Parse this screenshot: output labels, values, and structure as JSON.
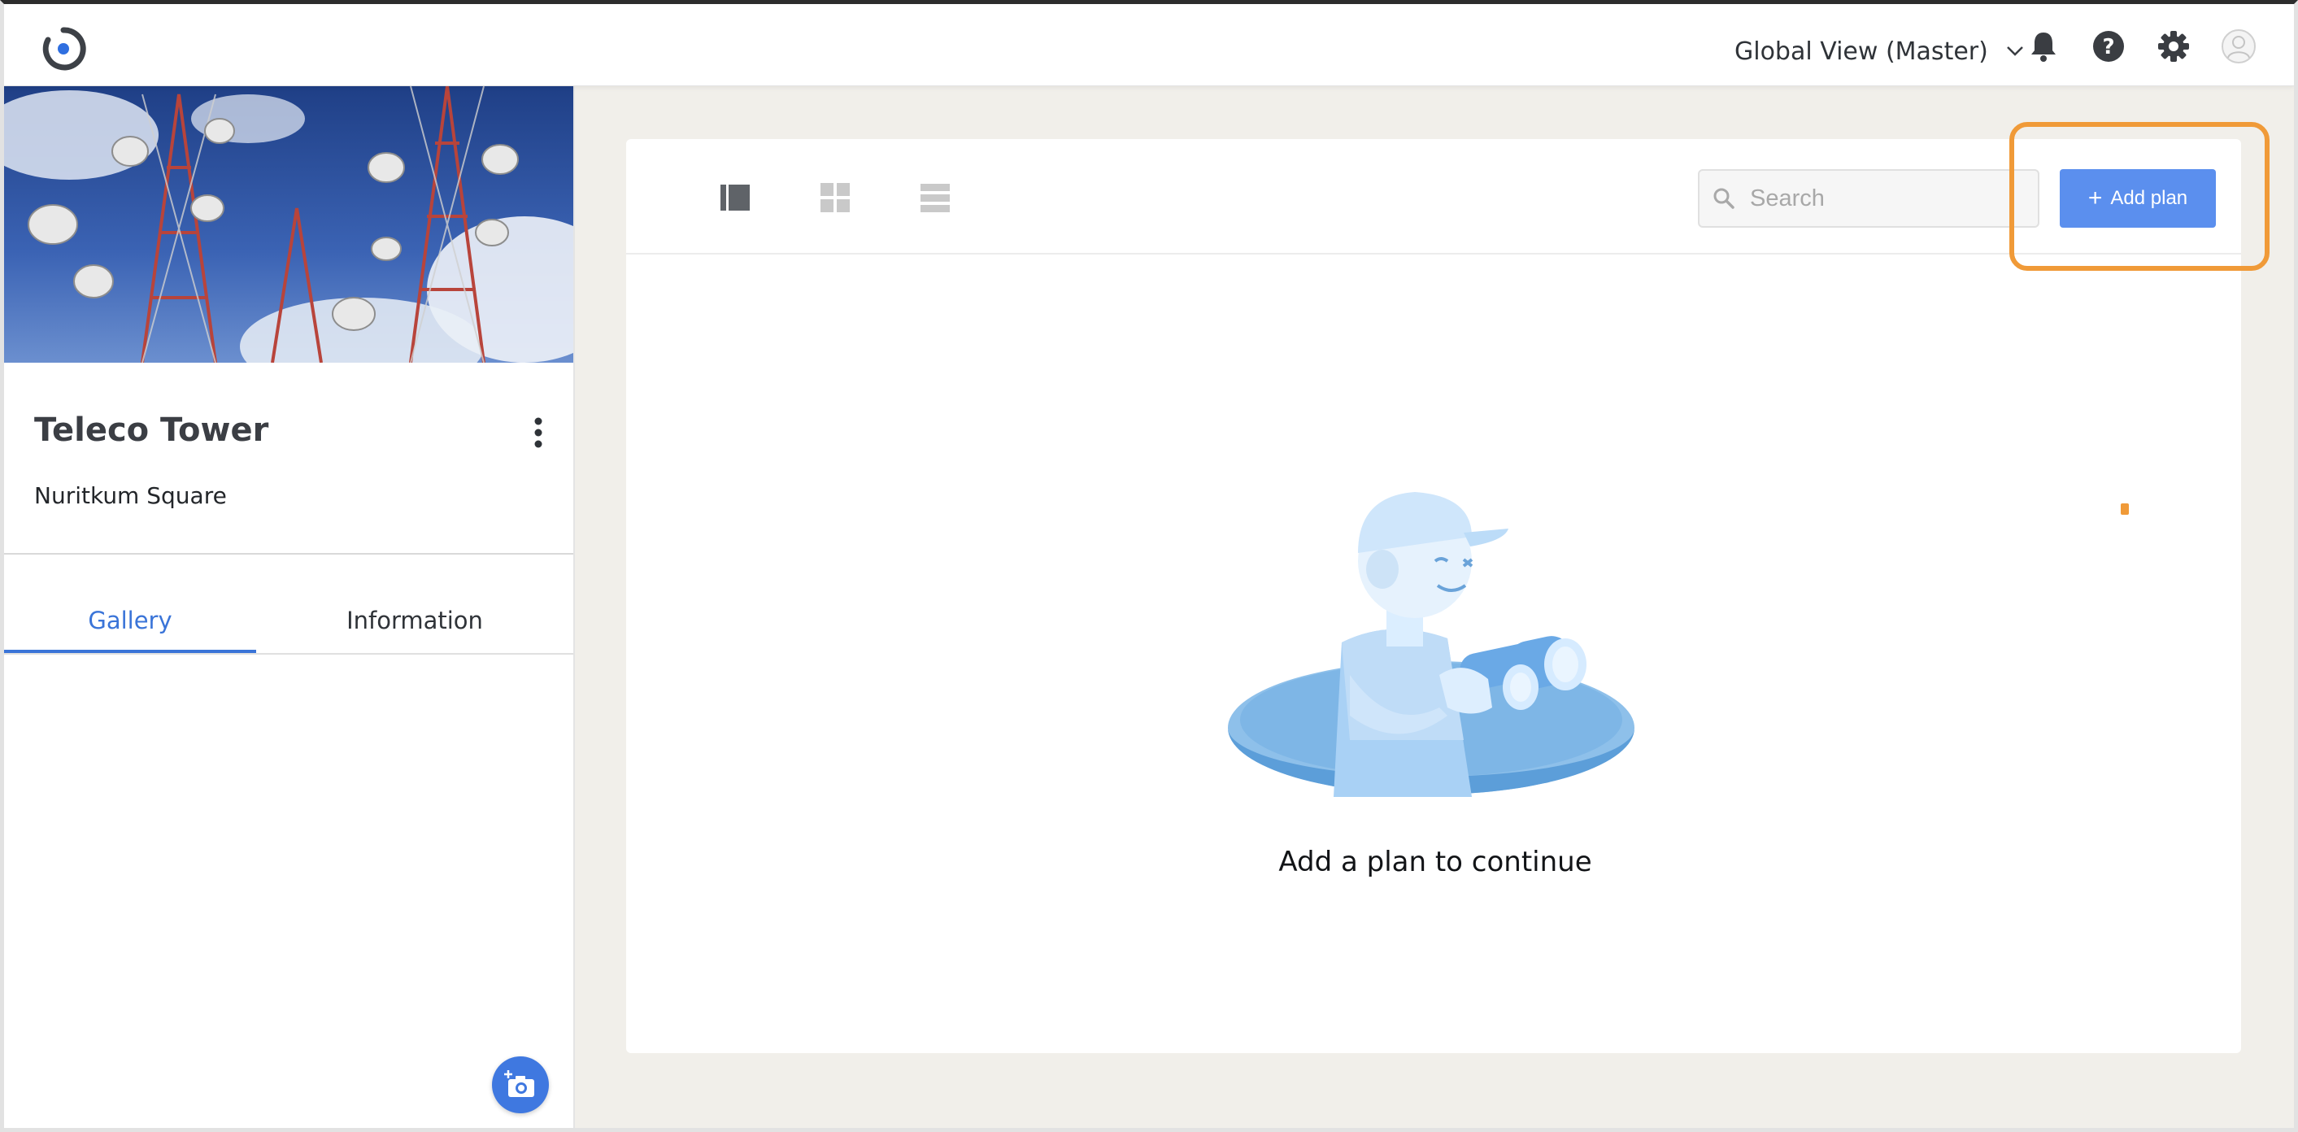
{
  "header": {
    "workspace_label": "Global View (Master)",
    "icons": [
      "bell-icon",
      "help-icon",
      "gear-icon",
      "avatar"
    ]
  },
  "site": {
    "title": "Teleco Tower",
    "subtitle": "Nuritkum Square"
  },
  "tabs": [
    {
      "label": "Gallery",
      "active": true
    },
    {
      "label": "Information",
      "active": false
    }
  ],
  "toolbar": {
    "view_modes": [
      "side-panel-view",
      "grid-view",
      "list-view"
    ],
    "active_view": "side-panel-view",
    "search_placeholder": "Search",
    "add_button_label": "Add plan"
  },
  "empty_state": {
    "message": "Add a plan to continue"
  },
  "colors": {
    "accent": "#3a74d8",
    "button": "#5b8fee",
    "highlight": "#f09a38",
    "background": "#f1efea"
  }
}
